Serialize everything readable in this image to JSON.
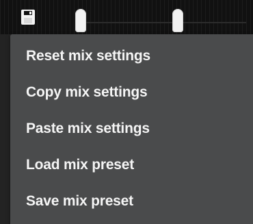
{
  "toolbar": {
    "save_icon": "floppy-disk-icon",
    "fader_handles": 2
  },
  "menu": {
    "items": [
      {
        "label": "Reset mix settings"
      },
      {
        "label": "Copy mix settings"
      },
      {
        "label": "Paste mix settings"
      },
      {
        "label": "Load mix preset"
      },
      {
        "label": "Save mix preset"
      }
    ]
  },
  "colors": {
    "menu_background": "#4a4b4c",
    "menu_text": "#f5f5f5",
    "strip_background": "#111111"
  }
}
